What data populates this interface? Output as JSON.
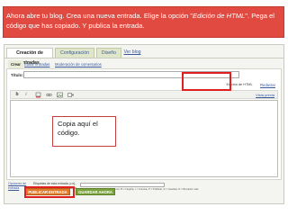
{
  "instruction": {
    "part1": "Ahora abre tu blog. Crea una nueva entrada. Elige la opción \"",
    "emphasis": "Edición de HTML",
    "part2": "\". Pega el código que has copiado. Y publica la entrada."
  },
  "tabs": {
    "posting": "Creación de entradas",
    "settings": "Configuración",
    "design": "Diseño",
    "view_blog": "Ver blog"
  },
  "subtabs": {
    "create": "Crear",
    "edit_posts": "Editar entradas",
    "moderate_comments": "Moderación de comentarios"
  },
  "editor": {
    "title_label": "Título:",
    "mode_html": "Edición de HTML",
    "mode_compose": "Redactar",
    "preview": "Vista previa",
    "toolbar": [
      "b",
      "i"
    ]
  },
  "note": {
    "line1": "Copia aquí el",
    "line2": "código."
  },
  "bottom": {
    "post_options": "Opciones de entrada",
    "labels_text": "Etiquetas de esta entrada: p.ej., motocicletas, vacaciones, otoño",
    "shortcuts": "Métodos abreviados: pulsa Ctrl con: B = Negrita, I = Cursiva, P = Publicar, S = Guardar, D = Borrador más"
  },
  "buttons": {
    "publish": "PUBLICAR ENTRADA",
    "save_now": "GUARDAR AHORA"
  },
  "colors": {
    "instruction_bg": "#e04a40",
    "highlight": "#e02020",
    "publish": "#e07a2a",
    "save": "#7aa33e",
    "tab_bg": "#dfe6c9"
  }
}
